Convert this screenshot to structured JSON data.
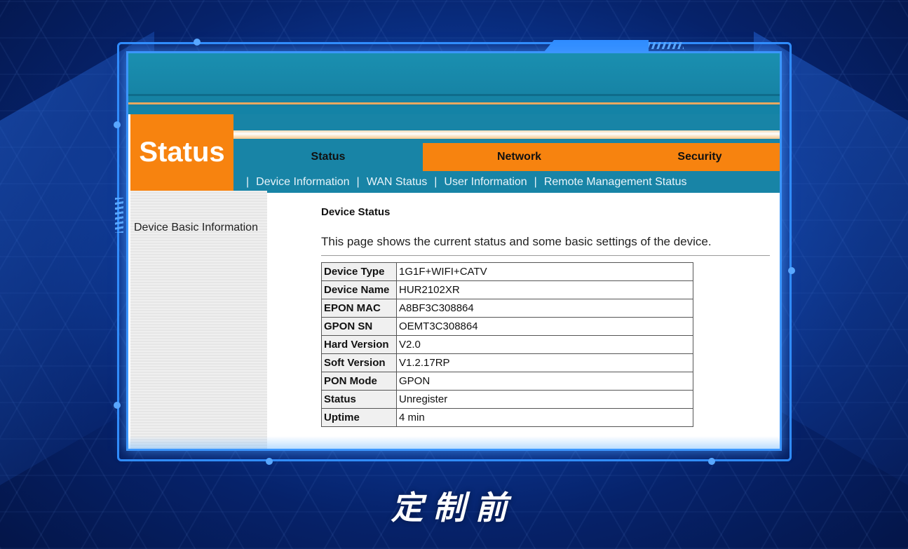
{
  "header": {
    "logo_text": "Status"
  },
  "tabs": [
    {
      "label": "Status",
      "active": true
    },
    {
      "label": "Network",
      "active": false
    },
    {
      "label": "Security",
      "active": false
    }
  ],
  "subnav": [
    "Device Information",
    "WAN Status",
    "User Information",
    "Remote Management Status"
  ],
  "sidebar": {
    "items": [
      "Device Basic Information"
    ]
  },
  "main": {
    "title": "Device Status",
    "description": "This page shows the current status and some basic settings of the device.",
    "rows": [
      {
        "key": "Device Type",
        "value": "1G1F+WIFI+CATV"
      },
      {
        "key": "Device Name",
        "value": "HUR2102XR"
      },
      {
        "key": "EPON MAC",
        "value": "A8BF3C308864"
      },
      {
        "key": "GPON SN",
        "value": "OEMT3C308864"
      },
      {
        "key": "Hard Version",
        "value": "V2.0"
      },
      {
        "key": "Soft Version",
        "value": "V1.2.17RP"
      },
      {
        "key": "PON Mode",
        "value": "GPON"
      },
      {
        "key": "Status",
        "value": "Unregister"
      },
      {
        "key": "Uptime",
        "value": "4 min"
      }
    ]
  },
  "caption": "定制前",
  "colors": {
    "orange": "#f7830f",
    "teal": "#1884a6",
    "frame_blue": "#2f8cff"
  }
}
